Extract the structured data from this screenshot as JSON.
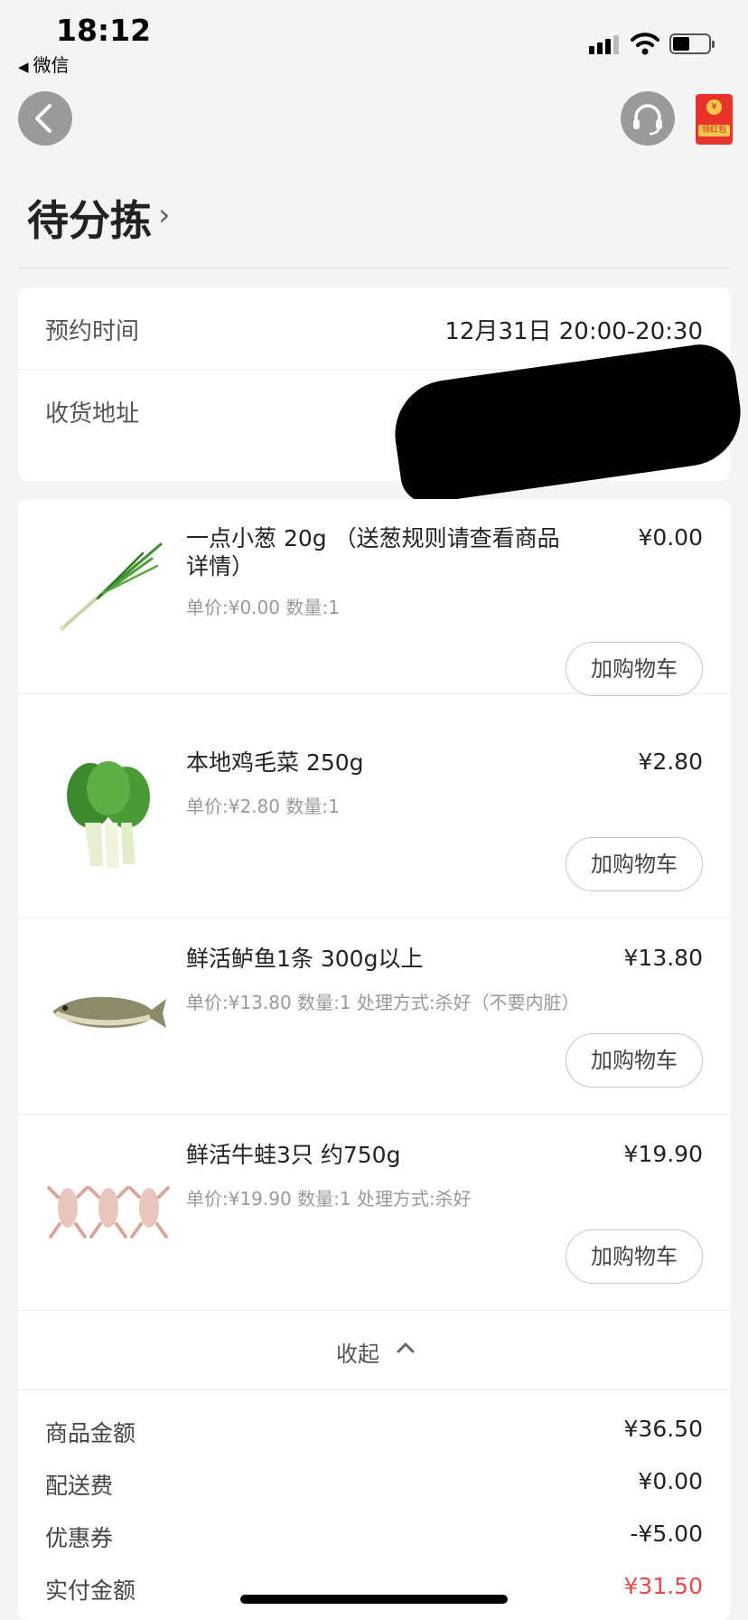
{
  "status_bar": {
    "time": "18:12",
    "back_app": "微信"
  },
  "nav": {
    "redpacket_tag": "领红包",
    "redpacket_coin": "¥"
  },
  "page_title": "待分拣",
  "order_info": {
    "reserve_label": "预约时间",
    "reserve_value": "12月31日 20:00-20:30",
    "address_label": "收货地址"
  },
  "items": [
    {
      "name": "一点小葱 20g （送葱规则请查看商品详情）",
      "price": "¥0.00",
      "sub": "单价:¥0.00 数量:1",
      "button": "加购物车",
      "icon": "scallion-image"
    },
    {
      "name": "本地鸡毛菜 250g",
      "price": "¥2.80",
      "sub": "单价:¥2.80 数量:1",
      "button": "加购物车",
      "icon": "greens-image"
    },
    {
      "name": "鲜活鲈鱼1条 300g以上",
      "price": "¥13.80",
      "sub": "单价:¥13.80 数量:1 处理方式:杀好（不要内脏）",
      "button": "加购物车",
      "icon": "fish-image"
    },
    {
      "name": "鲜活牛蛙3只 约750g",
      "price": "¥19.90",
      "sub": "单价:¥19.90 数量:1 处理方式:杀好",
      "button": "加购物车",
      "icon": "frog-image"
    }
  ],
  "collapse_label": "收起",
  "summary": [
    {
      "label": "商品金额",
      "value": "¥36.50"
    },
    {
      "label": "配送费",
      "value": "¥0.00"
    },
    {
      "label": "优惠券",
      "value": "-¥5.00"
    },
    {
      "label": "实付金额",
      "value": "¥31.50"
    }
  ],
  "colors": {
    "accent_red": "#e84a4a",
    "background": "#f4f4f4"
  }
}
